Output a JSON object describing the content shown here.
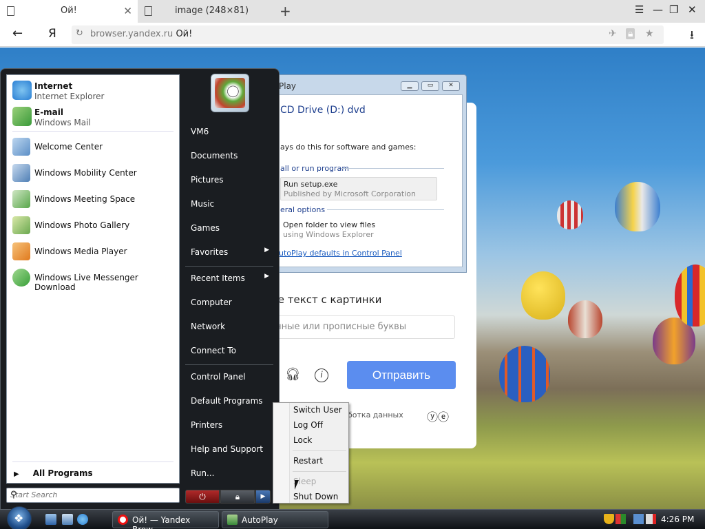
{
  "browser": {
    "tabs": [
      {
        "title": "Ой!"
      },
      {
        "title": "image (248×81)"
      }
    ],
    "new_tab": "+",
    "window_buttons": [
      "☰",
      "—",
      "❐",
      "✕"
    ],
    "address": {
      "host": "browser.yandex.ru",
      "path": "Ой!"
    },
    "yandex_logo": "Я"
  },
  "captcha": {
    "title": "те текст с картинки",
    "placeholder": "чные или прописные буквы",
    "send_label": "Отправить",
    "processing": "ботка данных"
  },
  "autoplay": {
    "title": "Play",
    "drive": "CD Drive (D:) dvd",
    "always": "ays do this for software and games:",
    "sec1": "all or run program",
    "opt1_l1": "Run setup.exe",
    "opt1_l2": "Published by Microsoft Corporation",
    "sec2": "eral options",
    "opt2_l1": "Open folder to view files",
    "opt2_l2": "using Windows Explorer",
    "link": "utoPlay defaults in Control Panel"
  },
  "start_menu": {
    "pinned": [
      {
        "title": "Internet",
        "subtitle": "Internet Explorer",
        "icon": "internet-explorer-icon",
        "color": "#2a7fd4"
      },
      {
        "title": "E-mail",
        "subtitle": "Windows Mail",
        "icon": "windows-mail-icon",
        "color": "#3a9a3a"
      }
    ],
    "programs": [
      {
        "label": "Welcome Center",
        "icon": "welcome-center-icon",
        "color": "#5c8fc7"
      },
      {
        "label": "Windows Mobility Center",
        "icon": "mobility-center-icon",
        "color": "#4f7fb5"
      },
      {
        "label": "Windows Meeting Space",
        "icon": "meeting-space-icon",
        "color": "#58a64a"
      },
      {
        "label": "Windows Photo Gallery",
        "icon": "photo-gallery-icon",
        "color": "#6aa84f"
      },
      {
        "label": "Windows Media Player",
        "icon": "media-player-icon",
        "color": "#e07a1e"
      },
      {
        "label": "Windows Live Messenger Download",
        "icon": "messenger-icon",
        "color": "#3aa03a"
      }
    ],
    "all_programs": "All Programs",
    "search_placeholder": "Start Search",
    "right_items": [
      {
        "label": "VM6"
      },
      {
        "label": "Documents"
      },
      {
        "label": "Pictures"
      },
      {
        "label": "Music"
      },
      {
        "label": "Games"
      },
      {
        "label": "Favorites",
        "submenu": true
      },
      {
        "label": "Recent Items",
        "submenu": true
      },
      {
        "label": "Computer"
      },
      {
        "label": "Network"
      },
      {
        "label": "Connect To"
      },
      {
        "label": "Control Panel"
      },
      {
        "label": "Default Programs"
      },
      {
        "label": "Printers"
      },
      {
        "label": "Help and Support"
      },
      {
        "label": "Run..."
      }
    ]
  },
  "power_menu": [
    {
      "label": "Switch User",
      "enabled": true
    },
    {
      "label": "Log Off",
      "enabled": true
    },
    {
      "label": "Lock",
      "enabled": true
    },
    {
      "label": "Restart",
      "enabled": true
    },
    {
      "label": "Sleep",
      "enabled": false
    },
    {
      "label": "Shut Down",
      "enabled": true
    }
  ],
  "taskbar": {
    "buttons": [
      {
        "label": "Ой! — Yandex Brow...",
        "icon": "yandex-browser-icon"
      },
      {
        "label": "AutoPlay",
        "icon": "autoplay-icon"
      }
    ],
    "clock": "4:26 PM"
  },
  "colors": {
    "accent": "#5b8def",
    "start_bg": "#1a1d21"
  }
}
